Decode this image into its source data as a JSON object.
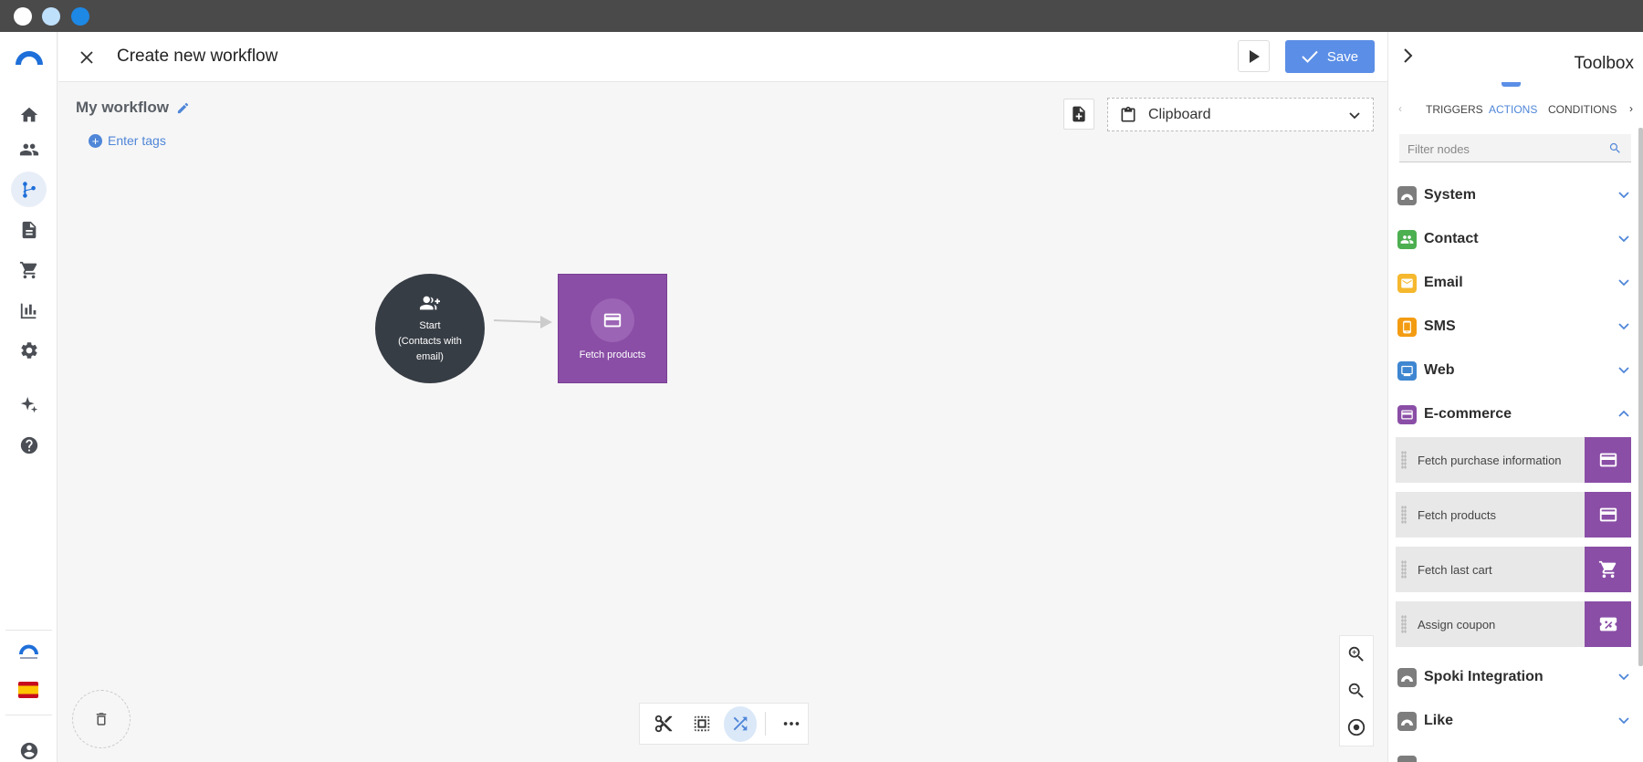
{
  "colors": {
    "accent": "#5b8ee6",
    "ecommerce": "#8a4ea6",
    "start_node": "#373d45"
  },
  "header": {
    "title": "Create new workflow",
    "save_label": "Save"
  },
  "canvas": {
    "workflow_name": "My workflow",
    "tags_label": "Enter tags",
    "clipboard_label": "Clipboard",
    "nodes": {
      "start_line1": "Start",
      "start_line2": "(Contacts with",
      "start_line3": "email)",
      "fetch_label": "Fetch products"
    }
  },
  "toolbox": {
    "title": "Toolbox",
    "tabs": [
      "TRIGGERS",
      "ACTIONS",
      "CONDITIONS"
    ],
    "active_tab": "ACTIONS",
    "filter_placeholder": "Filter nodes",
    "categories": [
      {
        "label": "System",
        "icon": "system-icon",
        "color": "#7d7d7d"
      },
      {
        "label": "Contact",
        "icon": "contacts-icon",
        "color": "#4caf50"
      },
      {
        "label": "Email",
        "icon": "mail-icon",
        "color": "#f5b82e"
      },
      {
        "label": "SMS",
        "icon": "phone-icon",
        "color": "#f39c12"
      },
      {
        "label": "Web",
        "icon": "monitor-icon",
        "color": "#3e86d1"
      },
      {
        "label": "E-commerce",
        "icon": "card-icon",
        "color": "#8a4ea6",
        "expanded": true
      },
      {
        "label": "Spoki Integration",
        "icon": "system-icon",
        "color": "#7d7d7d"
      },
      {
        "label": "Like",
        "icon": "system-icon",
        "color": "#7d7d7d"
      }
    ],
    "ecommerce_items": [
      {
        "label": "Fetch purchase information",
        "icon": "card-icon"
      },
      {
        "label": "Fetch products",
        "icon": "card-icon"
      },
      {
        "label": "Fetch last cart",
        "icon": "cart-icon"
      },
      {
        "label": "Assign coupon",
        "icon": "coupon-icon"
      }
    ]
  }
}
